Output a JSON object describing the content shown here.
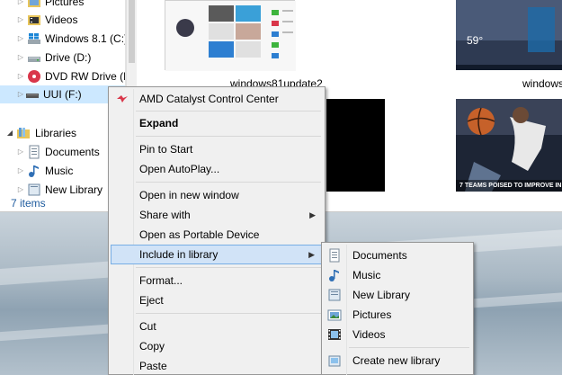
{
  "nav": {
    "items": [
      {
        "label": "Pictures",
        "icon": "pictures-folder-icon"
      },
      {
        "label": "Videos",
        "icon": "videos-folder-icon"
      },
      {
        "label": "Windows 8.1 (C:)",
        "icon": "windows-drive-icon"
      },
      {
        "label": "Drive (D:)",
        "icon": "drive-icon"
      },
      {
        "label": "DVD RW Drive (E:",
        "icon": "dvd-drive-icon"
      },
      {
        "label": "UUI (F:)",
        "icon": "usb-drive-icon"
      },
      {
        "label": "Libraries",
        "icon": "libraries-icon"
      },
      {
        "label": "Documents",
        "icon": "documents-icon"
      },
      {
        "label": "Music",
        "icon": "music-icon"
      },
      {
        "label": "New Library",
        "icon": "library-icon"
      }
    ]
  },
  "status": {
    "item_count": "7 items"
  },
  "content": {
    "captions": [
      "windows81update2",
      "windows"
    ],
    "weather_temp": "59°",
    "news_headline": "7 TEAMS POISED TO IMPROVE IN"
  },
  "context_menu": {
    "items": {
      "amd": "AMD Catalyst Control Center",
      "expand": "Expand",
      "pin": "Pin to Start",
      "autoplay": "Open AutoPlay...",
      "new_window": "Open in new window",
      "share": "Share with",
      "portable": "Open as Portable Device",
      "include": "Include in library",
      "format": "Format...",
      "eject": "Eject",
      "cut": "Cut",
      "copy": "Copy",
      "paste": "Paste"
    }
  },
  "submenu": {
    "items": {
      "documents": "Documents",
      "music": "Music",
      "new_library": "New Library",
      "pictures": "Pictures",
      "videos": "Videos",
      "create": "Create new library"
    }
  },
  "colors": {
    "selection": "#cce8ff",
    "menu_highlight": "#d1e3f7",
    "menu_border": "#78aee5",
    "status_text": "#1e5b9e"
  }
}
